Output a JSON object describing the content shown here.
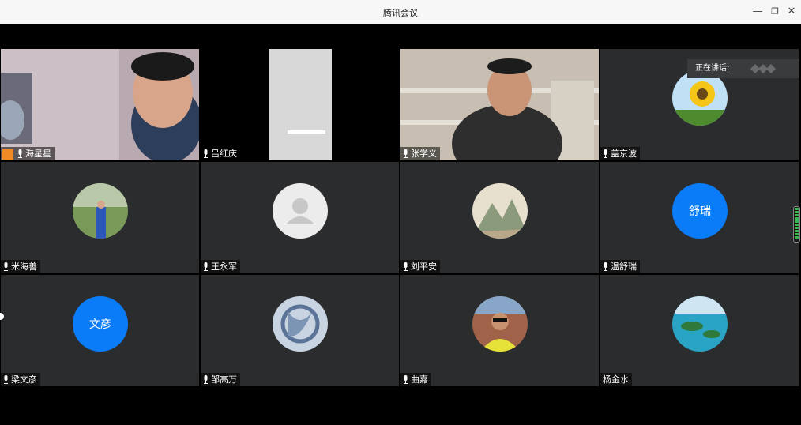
{
  "window": {
    "title": "腾讯会议",
    "controls": {
      "minimize": "—",
      "restore": "❐",
      "close": "✕"
    }
  },
  "speaking": {
    "label": "正在讲话:"
  },
  "participants": [
    {
      "name": "海星星",
      "type": "video"
    },
    {
      "name": "吕红庆",
      "type": "video"
    },
    {
      "name": "张学义",
      "type": "video"
    },
    {
      "name": "盖京波",
      "type": "avatar-image"
    },
    {
      "name": "米海善",
      "type": "avatar-image"
    },
    {
      "name": "王永军",
      "type": "avatar-placeholder"
    },
    {
      "name": "刘平安",
      "type": "avatar-image"
    },
    {
      "name": "温舒瑞",
      "type": "avatar-text",
      "avatar_text": "舒瑞"
    },
    {
      "name": "梁文彦",
      "type": "avatar-text",
      "avatar_text": "文彦"
    },
    {
      "name": "邹高万",
      "type": "avatar-image"
    },
    {
      "name": "曲嘉",
      "type": "avatar-image"
    },
    {
      "name": "杨金水",
      "type": "avatar-image"
    }
  ],
  "colors": {
    "tile_bg": "#2b2c2e",
    "accent": "#0a7cf7",
    "stage_bg": "#000000"
  }
}
